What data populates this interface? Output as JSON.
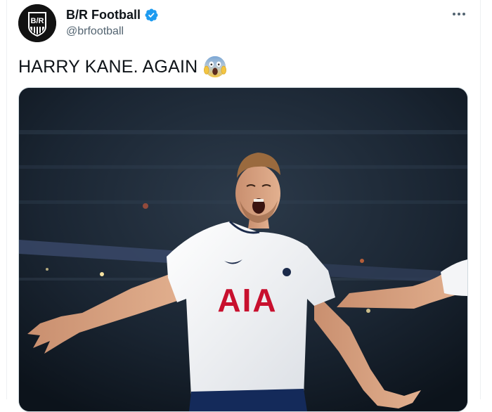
{
  "tweet": {
    "author": {
      "display_name": "B/R Football",
      "handle": "@brfootball",
      "verified": true,
      "avatar_text": "B/R"
    },
    "text": "HARRY KANE. AGAIN",
    "emoji": "face-screaming-in-fear-emoji",
    "media": {
      "shirt_sponsor": "AIA"
    }
  },
  "colors": {
    "name": "#0f1419",
    "handle": "#536471",
    "verified": "#1d9bf0",
    "shirt_sponsor": "#c8102e"
  }
}
